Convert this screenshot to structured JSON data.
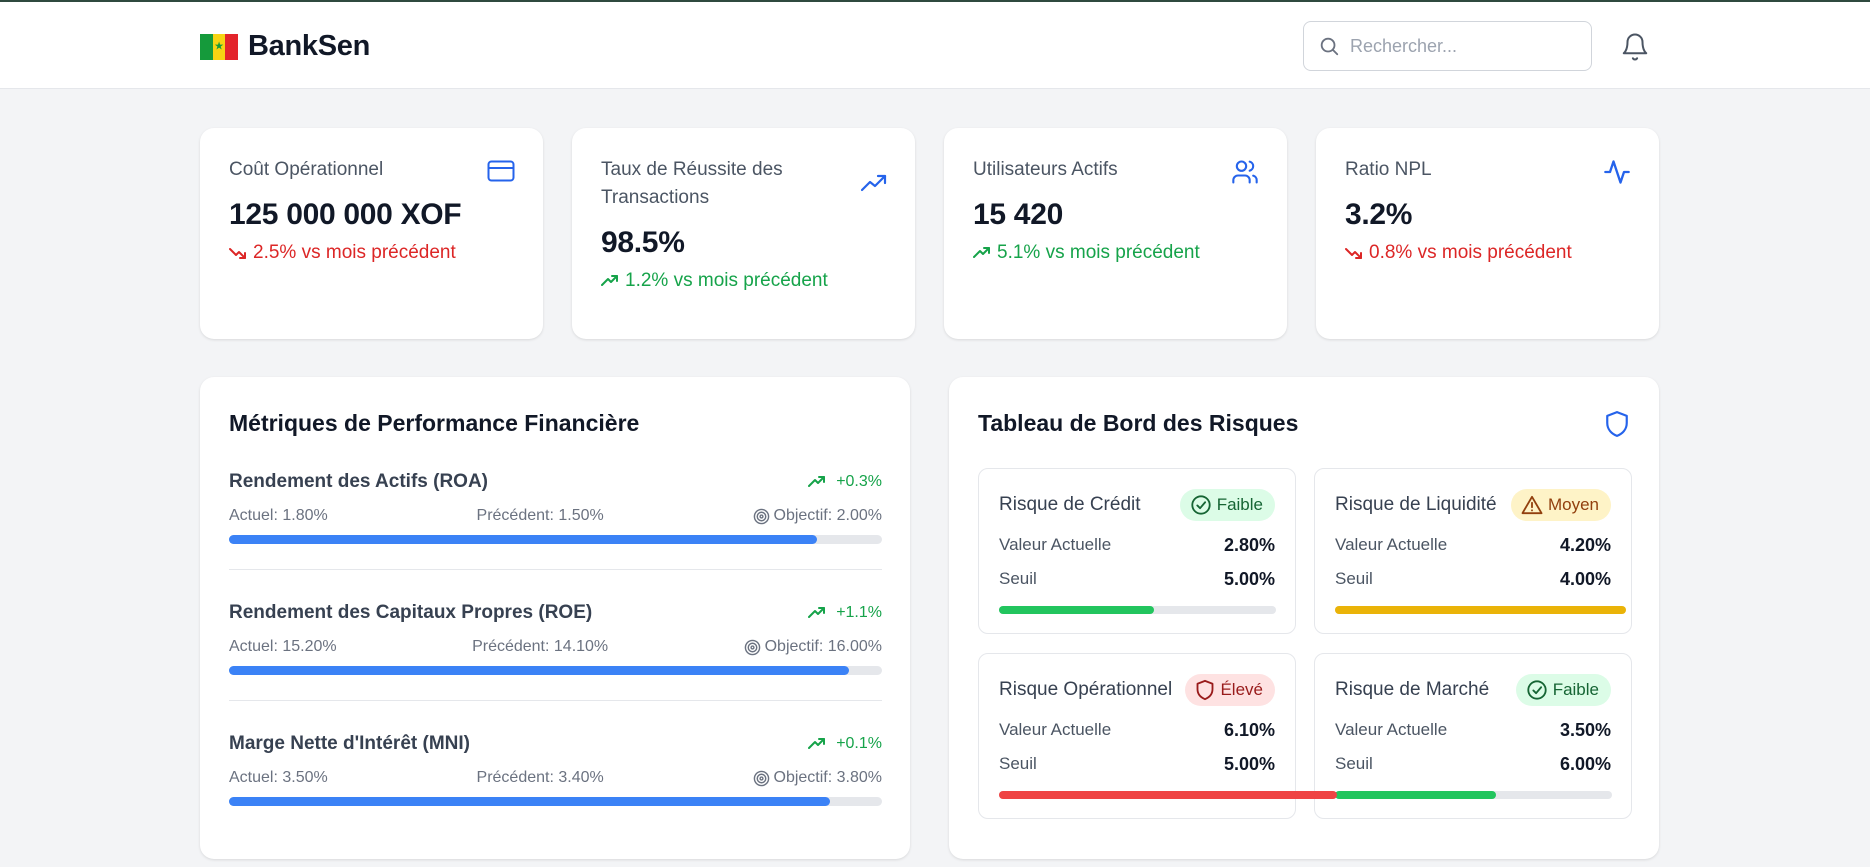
{
  "header": {
    "brand": "BankSen",
    "search_placeholder": "Rechercher..."
  },
  "stats": [
    {
      "title": "Coût Opérationnel",
      "icon": "credit-card-icon",
      "value": "125 000 000 XOF",
      "change": "2.5% vs mois précédent",
      "trend": "down"
    },
    {
      "title": "Taux de Réussite des Transactions",
      "icon": "trending-up-icon",
      "value": "98.5%",
      "change": "1.2% vs mois précédent",
      "trend": "up"
    },
    {
      "title": "Utilisateurs Actifs",
      "icon": "users-icon",
      "value": "15 420",
      "change": "5.1% vs mois précédent",
      "trend": "up"
    },
    {
      "title": "Ratio NPL",
      "icon": "activity-icon",
      "value": "3.2%",
      "change": "0.8% vs mois précédent",
      "trend": "down"
    }
  ],
  "performance": {
    "title": "Métriques de Performance Financière",
    "metrics": [
      {
        "name": "Rendement des Actifs (ROA)",
        "delta": "+0.3%",
        "current": "Actuel: 1.80%",
        "previous": "Précédent: 1.50%",
        "target": "Objectif: 2.00%",
        "progress": 0.9
      },
      {
        "name": "Rendement des Capitaux Propres (ROE)",
        "delta": "+1.1%",
        "current": "Actuel: 15.20%",
        "previous": "Précédent: 14.10%",
        "target": "Objectif: 16.00%",
        "progress": 0.95
      },
      {
        "name": "Marge Nette d'Intérêt (MNI)",
        "delta": "+0.1%",
        "current": "Actuel: 3.50%",
        "previous": "Précédent: 3.40%",
        "target": "Objectif: 3.80%",
        "progress": 0.921
      }
    ]
  },
  "risks": {
    "title": "Tableau de Bord des Risques",
    "current_label": "Valeur Actuelle",
    "threshold_label": "Seuil",
    "items": [
      {
        "name": "Risque de Crédit",
        "level": "Faible",
        "level_type": "low",
        "value": "2.80%",
        "threshold": "5.00%",
        "ratio": 0.56,
        "bar_color": "#22c55e"
      },
      {
        "name": "Risque de Liquidité",
        "level": "Moyen",
        "level_type": "mid",
        "value": "4.20%",
        "threshold": "4.00%",
        "ratio": 1.05,
        "bar_color": "#eab308"
      },
      {
        "name": "Risque Opérationnel",
        "level": "Élevé",
        "level_type": "high",
        "value": "6.10%",
        "threshold": "5.00%",
        "ratio": 1.22,
        "bar_color": "#ef4444"
      },
      {
        "name": "Risque de Marché",
        "level": "Faible",
        "level_type": "low",
        "value": "3.50%",
        "threshold": "6.00%",
        "ratio": 0.583,
        "bar_color": "#22c55e"
      }
    ]
  }
}
